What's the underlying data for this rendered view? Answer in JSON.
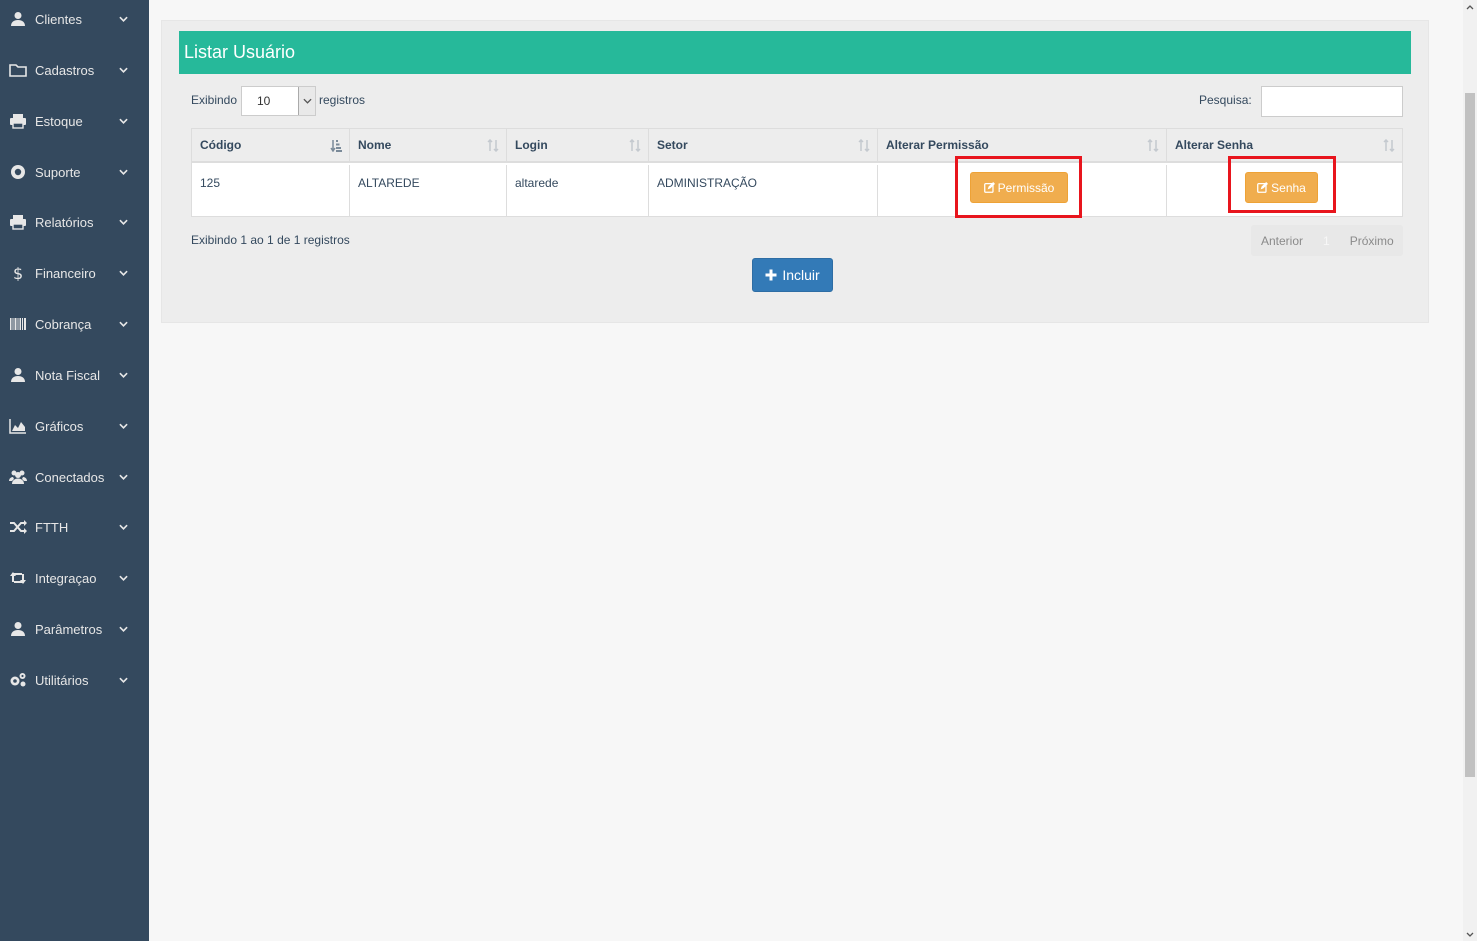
{
  "sidebar": {
    "items": [
      {
        "label": "Clientes",
        "icon": "user-icon"
      },
      {
        "label": "Cadastros",
        "icon": "folder-icon"
      },
      {
        "label": "Estoque",
        "icon": "printer-icon"
      },
      {
        "label": "Suporte",
        "icon": "lifebuoy-icon"
      },
      {
        "label": "Relatórios",
        "icon": "printer-icon"
      },
      {
        "label": "Financeiro",
        "icon": "dollar-icon"
      },
      {
        "label": "Cobrança",
        "icon": "barcode-icon"
      },
      {
        "label": "Nota Fiscal",
        "icon": "user-icon"
      },
      {
        "label": "Gráficos",
        "icon": "area-chart-icon"
      },
      {
        "label": "Conectados",
        "icon": "users-icon"
      },
      {
        "label": "FTTH",
        "icon": "random-icon"
      },
      {
        "label": "Integraçao",
        "icon": "retweet-icon"
      },
      {
        "label": "Parâmetros",
        "icon": "user-icon"
      },
      {
        "label": "Utilitários",
        "icon": "cogs-icon"
      }
    ]
  },
  "panel": {
    "title": "Listar Usuário"
  },
  "controls": {
    "length_prefix": "Exibindo",
    "length_value": "10",
    "length_suffix": "registros",
    "search_label": "Pesquisa:",
    "search_value": ""
  },
  "table": {
    "headers": [
      "Código",
      "Nome",
      "Login",
      "Setor",
      "Alterar Permissão",
      "Alterar Senha"
    ],
    "rows": [
      {
        "codigo": "125",
        "nome": "ALTAREDE",
        "login": "altarede",
        "setor": "ADMINISTRAÇÃO",
        "permissao_label": "Permissão",
        "senha_label": "Senha"
      }
    ]
  },
  "footer": {
    "info": "Exibindo 1 ao 1 de 1 registros",
    "prev": "Anterior",
    "page": "1",
    "next": "Próximo",
    "add_label": "Incluir"
  },
  "colors": {
    "sidebar_bg": "#34495e",
    "title_bg": "#26b99a",
    "warning": "#f0ad4e",
    "primary": "#337ab7",
    "highlight": "#e8151d"
  }
}
